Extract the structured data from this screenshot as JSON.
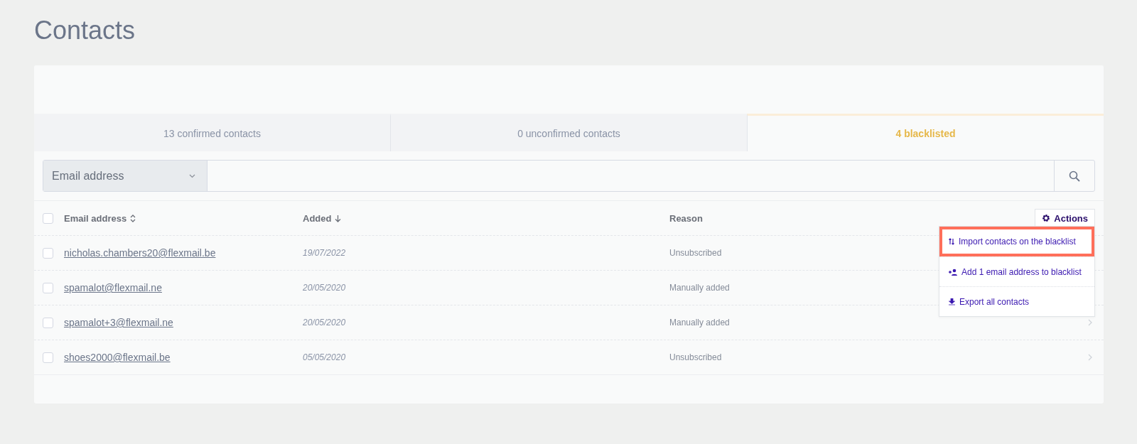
{
  "title": "Contacts",
  "tabs": [
    {
      "label": "13 confirmed contacts",
      "selected": false
    },
    {
      "label": "0 unconfirmed contacts",
      "selected": false
    },
    {
      "label": "4 blacklisted",
      "selected": true
    }
  ],
  "search": {
    "field_select": "Email address"
  },
  "table": {
    "all_checked": false,
    "columns": [
      {
        "label": "Email address",
        "sortable": true,
        "sorted": false
      },
      {
        "label": "Added",
        "sortable": true,
        "sorted": true
      },
      {
        "label": "Reason",
        "sortable": false
      }
    ],
    "rows": [
      {
        "checked": false,
        "email": "nicholas.chambers20@flexmail.be",
        "added": "19/07/2022",
        "reason": "Unsubscribed"
      },
      {
        "checked": false,
        "email": "spamalot@flexmail.ne",
        "added": "20/05/2020",
        "reason": "Manually added"
      },
      {
        "checked": false,
        "email": "spamalot+3@flexmail.ne",
        "added": "20/05/2020",
        "reason": "Manually added",
        "chevron": true
      },
      {
        "checked": false,
        "email": "shoes2000@flexmail.be",
        "added": "05/05/2020",
        "reason": "Unsubscribed",
        "chevron": true
      }
    ]
  },
  "actions": {
    "label": "Actions",
    "menu": [
      {
        "kind": "import",
        "label": "Import contacts on the blacklist",
        "highlighted": true
      },
      {
        "kind": "add",
        "label": "Add 1 email address to blacklist",
        "highlighted": false
      },
      {
        "kind": "export",
        "label": "Export all contacts",
        "highlighted": false
      }
    ]
  }
}
